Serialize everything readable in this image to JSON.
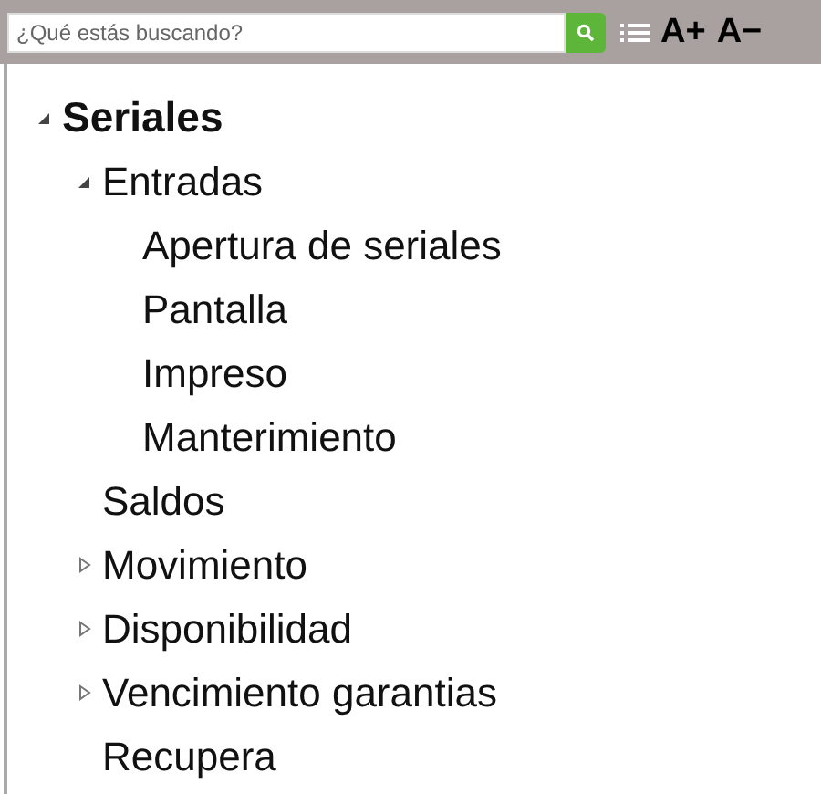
{
  "toolbar": {
    "search": {
      "placeholder": "¿Qué estás buscando?"
    },
    "font_increase": "A+",
    "font_decrease": "A−"
  },
  "tree": [
    {
      "label": "Seriales",
      "expanded": true,
      "children": [
        {
          "label": "Entradas",
          "expanded": true,
          "children": [
            {
              "label": "Apertura de seriales"
            },
            {
              "label": "Pantalla"
            },
            {
              "label": "Impreso"
            },
            {
              "label": "Manterimiento"
            }
          ]
        },
        {
          "label": "Saldos"
        },
        {
          "label": "Movimiento",
          "expanded": false
        },
        {
          "label": "Disponibilidad",
          "expanded": false
        },
        {
          "label": "Vencimiento garantias",
          "expanded": false
        },
        {
          "label": "Recupera"
        }
      ]
    }
  ]
}
